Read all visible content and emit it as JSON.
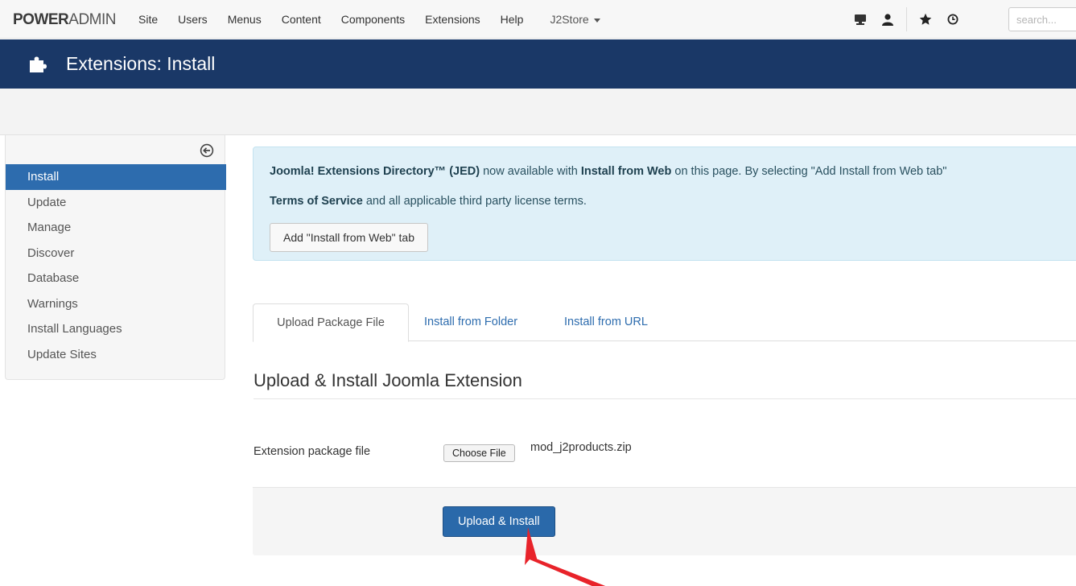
{
  "navbar": {
    "brand_bold": "POWER",
    "brand_light": "ADMIN",
    "menu": [
      "Site",
      "Users",
      "Menus",
      "Content",
      "Components",
      "Extensions",
      "Help"
    ],
    "store_menu": "J2Store",
    "icons": [
      "monitor-icon",
      "user-icon",
      "star-icon",
      "clock-icon"
    ],
    "search_placeholder": "search..."
  },
  "header": {
    "icon": "puzzle-icon",
    "title": "Extensions: Install"
  },
  "sidebar": {
    "collapse_icon": "circle-arrow-left-icon",
    "items": [
      {
        "label": "Install",
        "active": true
      },
      {
        "label": "Update",
        "active": false
      },
      {
        "label": "Manage",
        "active": false
      },
      {
        "label": "Discover",
        "active": false
      },
      {
        "label": "Database",
        "active": false
      },
      {
        "label": "Warnings",
        "active": false
      },
      {
        "label": "Install Languages",
        "active": false
      },
      {
        "label": "Update Sites",
        "active": false
      }
    ]
  },
  "alert": {
    "jed_name": "Joomla! Extensions Directory™ (JED)",
    "text_a": " now available with ",
    "install_from_web": "Install from Web",
    "text_b": " on this page. By selecting \"Add Install from Web tab\" ",
    "tos": "Terms of Service",
    "text_c": " and all applicable third party license terms.",
    "button_label": "Add \"Install from Web\" tab"
  },
  "tabs": [
    {
      "label": "Upload Package File",
      "active": true
    },
    {
      "label": "Install from Folder",
      "active": false
    },
    {
      "label": "Install from URL",
      "active": false
    }
  ],
  "form": {
    "legend": "Upload & Install Joomla Extension",
    "file_label": "Extension package file",
    "choose_file_label": "Choose File",
    "file_name": "mod_j2products.zip",
    "submit_label": "Upload & Install"
  },
  "colors": {
    "header_bg": "#1a3867",
    "accent": "#2d6cae",
    "annotation_arrow": "#e8232a"
  }
}
